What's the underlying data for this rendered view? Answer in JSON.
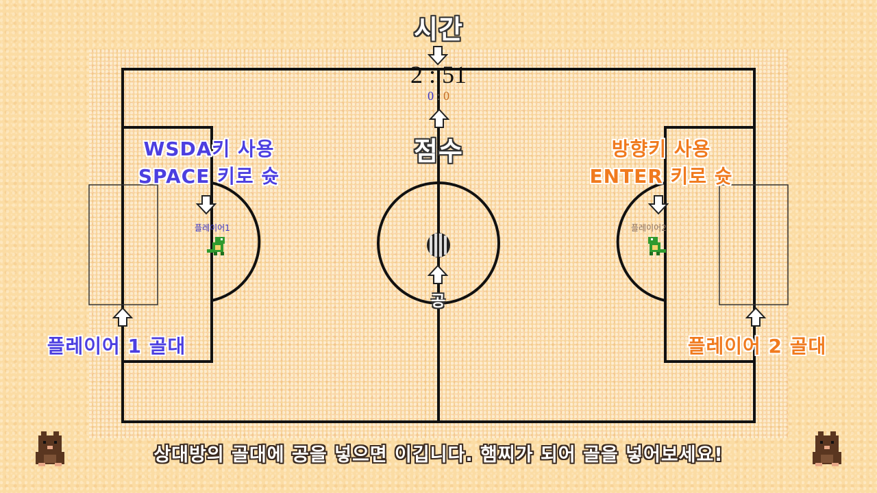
{
  "labels": {
    "time_title": "시간",
    "score_title": "점수",
    "ball_label": "공",
    "p1_controls_line1": "WSDA키 사용",
    "p1_controls_line2": "SPACE 키로 슛",
    "p2_controls_line1": "방향키 사용",
    "p2_controls_line2": "ENTER 키로 슛",
    "p1_goal": "플레이어 1 골대",
    "p2_goal": "플레이어 2 골대",
    "p1_name": "플레이어1",
    "p2_name": "플레이어2"
  },
  "timer": "2 : 51",
  "score": {
    "p1": "0",
    "sep": ":",
    "p2": "0"
  },
  "footer": "상대방의 골대에 공을 넣으면 이깁니다. 햄찌가 되어 골을 넣어보세요!",
  "colors": {
    "player1": "#4c3fe0",
    "player2": "#f07a1e",
    "lines": "#111111"
  },
  "icons": [
    "arrow-down-icon",
    "arrow-up-icon",
    "ball-icon",
    "dino-icon",
    "mole-icon"
  ]
}
